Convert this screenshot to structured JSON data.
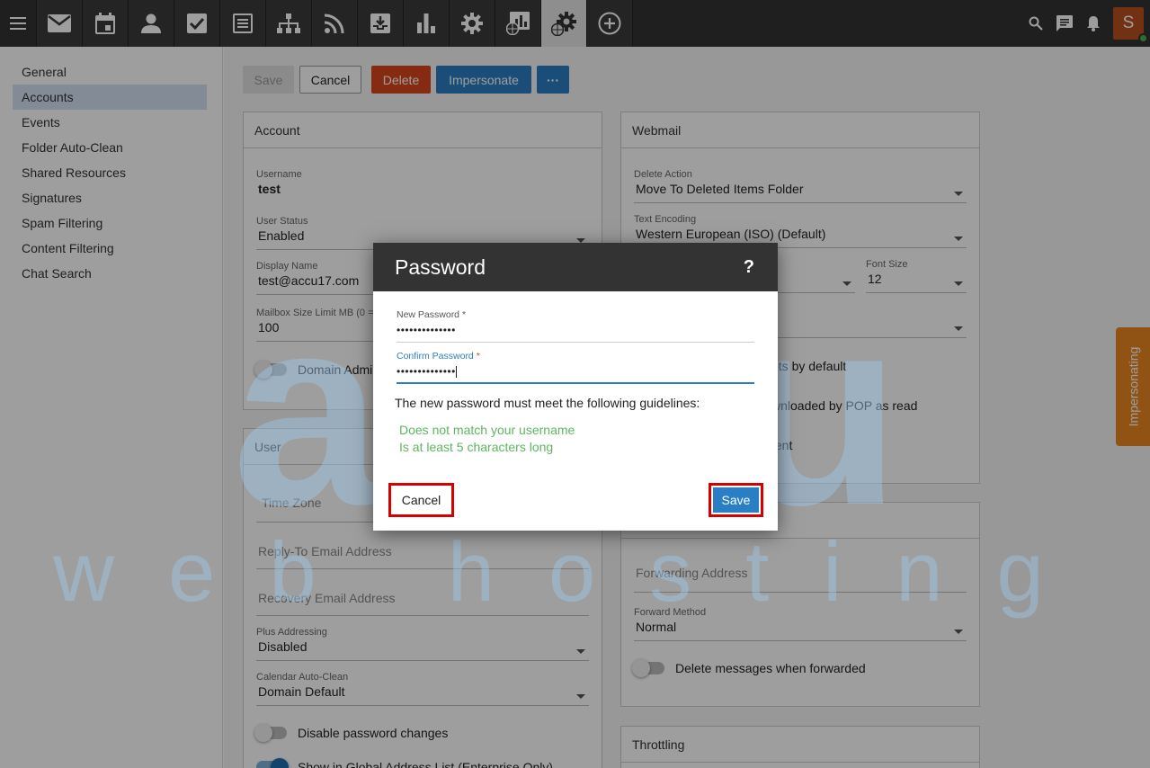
{
  "topbar": {
    "apps": [
      {
        "icon": "mail-icon"
      },
      {
        "icon": "calendar-icon"
      },
      {
        "icon": "contacts-icon"
      },
      {
        "icon": "tasks-icon"
      },
      {
        "icon": "notes-icon"
      },
      {
        "icon": "sitemap-icon"
      },
      {
        "icon": "rss-icon"
      },
      {
        "icon": "inbox-download-icon"
      },
      {
        "icon": "bar-chart-icon"
      },
      {
        "icon": "gear-icon"
      },
      {
        "icon": "domain-reports-icon"
      },
      {
        "icon": "domain-settings-icon"
      },
      {
        "icon": "add-circle-icon"
      }
    ],
    "avatar_initial": "S"
  },
  "sidebar": {
    "items": [
      {
        "label": "General"
      },
      {
        "label": "Accounts"
      },
      {
        "label": "Events"
      },
      {
        "label": "Folder Auto-Clean"
      },
      {
        "label": "Shared Resources"
      },
      {
        "label": "Signatures"
      },
      {
        "label": "Spam Filtering"
      },
      {
        "label": "Content Filtering"
      },
      {
        "label": "Chat Search"
      }
    ],
    "active": "Accounts"
  },
  "toolbar": {
    "save": "Save",
    "cancel": "Cancel",
    "delete": "Delete",
    "impersonate": "Impersonate",
    "more": "···"
  },
  "account": {
    "title": "Account",
    "username_label": "Username",
    "username": "test",
    "status_label": "User Status",
    "status": "Enabled",
    "display_label": "Display Name",
    "display": "test@accu17.com",
    "mailbox_label": "Mailbox Size Limit MB (0 = U",
    "mailbox": "100",
    "domain_admin": "Domain Admin"
  },
  "user": {
    "title": "User",
    "timezone_ph": "Time Zone",
    "reply_ph": "Reply-To Email Address",
    "recovery_ph": "Recovery Email Address",
    "plus_label": "Plus Addressing",
    "plus": "Disabled",
    "cal_label": "Calendar Auto-Clean",
    "cal": "Domain Default",
    "disable_pw": "Disable password changes",
    "global_list": "Show in Global Address List (Enterprise Only)"
  },
  "webmail": {
    "title": "Webmail",
    "delete_label": "Delete Action",
    "delete": "Move To Deleted Items Folder",
    "enc_label": "Text Encoding",
    "enc": "Western European (ISO) (Default)",
    "font_label": "Font Size",
    "font": "12",
    "opt1": "pts by default",
    "opt2": "wnloaded by POP as read",
    "opt3": "tent"
  },
  "forwarding": {
    "address_ph": "Forwarding Address",
    "method_label": "Forward Method",
    "method": "Normal",
    "delete_fwd": "Delete messages when forwarded"
  },
  "throttling": {
    "title": "Throttling"
  },
  "impersonating_tab": "Impersonating",
  "watermark": {
    "brand": "accu",
    "tagline": "web hosting"
  },
  "dialog": {
    "title": "Password",
    "help": "?",
    "new_label": "New Password",
    "new_value": "••••••••••••••",
    "confirm_label": "Confirm Password",
    "confirm_value": "••••••••••••••",
    "required_mark": "*",
    "guidelines": "The new password must meet the following guidelines:",
    "rule1": "Does not match your username",
    "rule2": "Is at least 5 characters long",
    "cancel": "Cancel",
    "save": "Save"
  }
}
